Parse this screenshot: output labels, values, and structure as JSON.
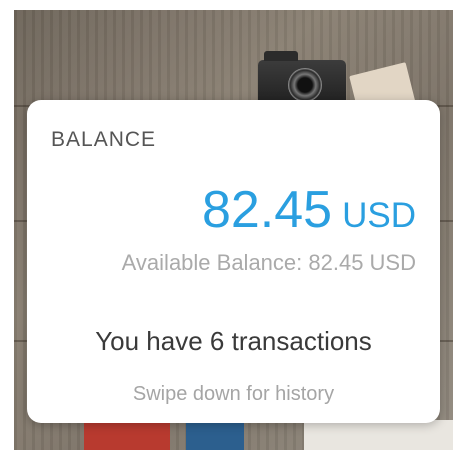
{
  "card": {
    "heading": "BALANCE",
    "amount": "82.45",
    "currency": "USD",
    "available_text": "Available Balance: 82.45 USD",
    "transactions_text": "You have 6 transactions",
    "swipe_hint": "Swipe down for history"
  },
  "colors": {
    "accent": "#2a9fe0",
    "card_bg": "#ffffff",
    "primary_text": "#3a3a3a",
    "secondary_text": "#aaaaaa"
  }
}
